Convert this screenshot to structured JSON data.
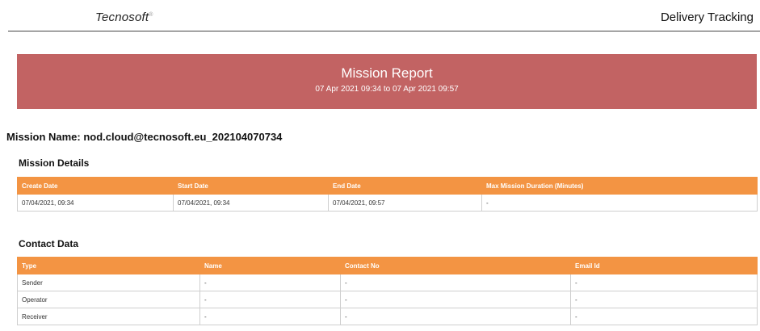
{
  "header": {
    "brand": "Tecnosoft",
    "app_title": "Delivery Tracking"
  },
  "banner": {
    "title": "Mission Report",
    "range": "07 Apr 2021 09:34 to 07 Apr 2021 09:57"
  },
  "mission": {
    "name_line": "Mission Name: nod.cloud@tecnosoft.eu_202104070734"
  },
  "mission_details": {
    "title": "Mission Details",
    "columns": [
      "Create Date",
      "Start Date",
      "End Date",
      "Max Mission Duration (Minutes)"
    ],
    "row": [
      "07/04/2021, 09:34",
      "07/04/2021, 09:34",
      "07/04/2021, 09:57",
      "-"
    ]
  },
  "contact_data": {
    "title": "Contact Data",
    "columns": [
      "Type",
      "Name",
      "Contact No",
      "Email Id"
    ],
    "rows": [
      [
        "Sender",
        "-",
        "-",
        "-"
      ],
      [
        "Operator",
        "-",
        "-",
        "-"
      ],
      [
        "Receiver",
        "-",
        "-",
        "-"
      ]
    ]
  },
  "colors": {
    "banner": "#c26363",
    "table_header": "#f39443"
  }
}
